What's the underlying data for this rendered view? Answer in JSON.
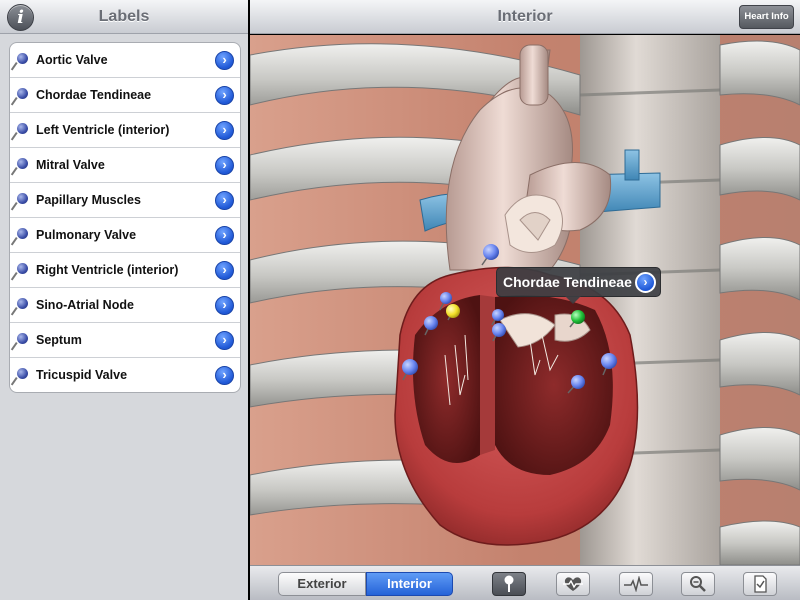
{
  "left_panel": {
    "title": "Labels",
    "info_icon_glyph": "i",
    "items": [
      {
        "label": "Aortic Valve"
      },
      {
        "label": "Chordae Tendineae"
      },
      {
        "label": "Left Ventricle (interior)"
      },
      {
        "label": "Mitral Valve"
      },
      {
        "label": "Papillary Muscles"
      },
      {
        "label": "Pulmonary Valve"
      },
      {
        "label": "Right Ventricle (interior)"
      },
      {
        "label": "Sino-Atrial Node"
      },
      {
        "label": "Septum"
      },
      {
        "label": "Tricuspid Valve"
      }
    ]
  },
  "right_panel": {
    "title": "Interior",
    "heart_info_label": "Heart Info",
    "callout_label": "Chordae Tendineae",
    "toolbar": {
      "segments": {
        "exterior": "Exterior",
        "interior": "Interior"
      },
      "selected_segment": "interior",
      "tools": [
        {
          "icon": "pin-icon",
          "active": true
        },
        {
          "icon": "heart-icon",
          "active": false
        },
        {
          "icon": "heartbeat-icon",
          "active": false
        },
        {
          "icon": "zoom-icon",
          "active": false
        },
        {
          "icon": "document-icon",
          "active": false
        }
      ]
    }
  },
  "colors": {
    "accent_blue": "#2563d8",
    "selected_pin_green": "#22c23a",
    "highlight_pin_yellow": "#f3e12a",
    "pin_blue": "#6a86f0"
  }
}
